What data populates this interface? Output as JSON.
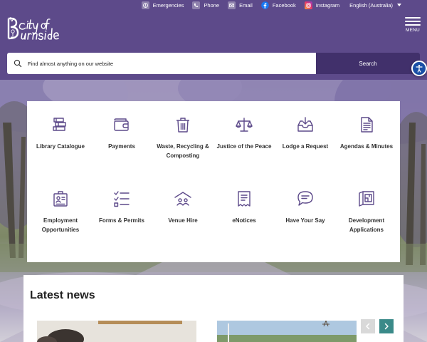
{
  "header": {
    "logo_text": "City of Burnside",
    "menu_label": "MENU",
    "top_links": [
      {
        "label": "Emergencies",
        "icon": "emergency-icon"
      },
      {
        "label": "Phone",
        "icon": "phone-icon"
      },
      {
        "label": "Email",
        "icon": "email-icon"
      },
      {
        "label": "Facebook",
        "icon": "facebook-icon"
      },
      {
        "label": "Instagram",
        "icon": "instagram-icon"
      }
    ],
    "language": "English (Australia)"
  },
  "search": {
    "placeholder": "Find almost anything on our website",
    "button_label": "Search"
  },
  "services": [
    {
      "label": "Library Catalogue",
      "icon": "books-icon"
    },
    {
      "label": "Payments",
      "icon": "wallet-icon"
    },
    {
      "label": "Waste, Recycling & Composting",
      "icon": "bin-icon"
    },
    {
      "label": "Justice of the Peace",
      "icon": "scales-icon"
    },
    {
      "label": "Lodge a Request",
      "icon": "inbox-icon"
    },
    {
      "label": "Agendas & Minutes",
      "icon": "document-icon"
    },
    {
      "label": "Employment Opportunities",
      "icon": "id-badge-icon"
    },
    {
      "label": "Forms & Permits",
      "icon": "checklist-icon"
    },
    {
      "label": "Venue Hire",
      "icon": "venue-icon"
    },
    {
      "label": "eNotices",
      "icon": "notice-icon"
    },
    {
      "label": "Have Your Say",
      "icon": "speech-bubble-icon"
    },
    {
      "label": "Development Applications",
      "icon": "plans-icon"
    }
  ],
  "news": {
    "title": "Latest news"
  },
  "colors": {
    "brand_purple": "#5d4a8a",
    "search_button": "#41306b",
    "icon_stroke": "#5d4a8a",
    "carousel_next": "#3a8a89",
    "accessibility_blue": "#1a4fa6"
  }
}
